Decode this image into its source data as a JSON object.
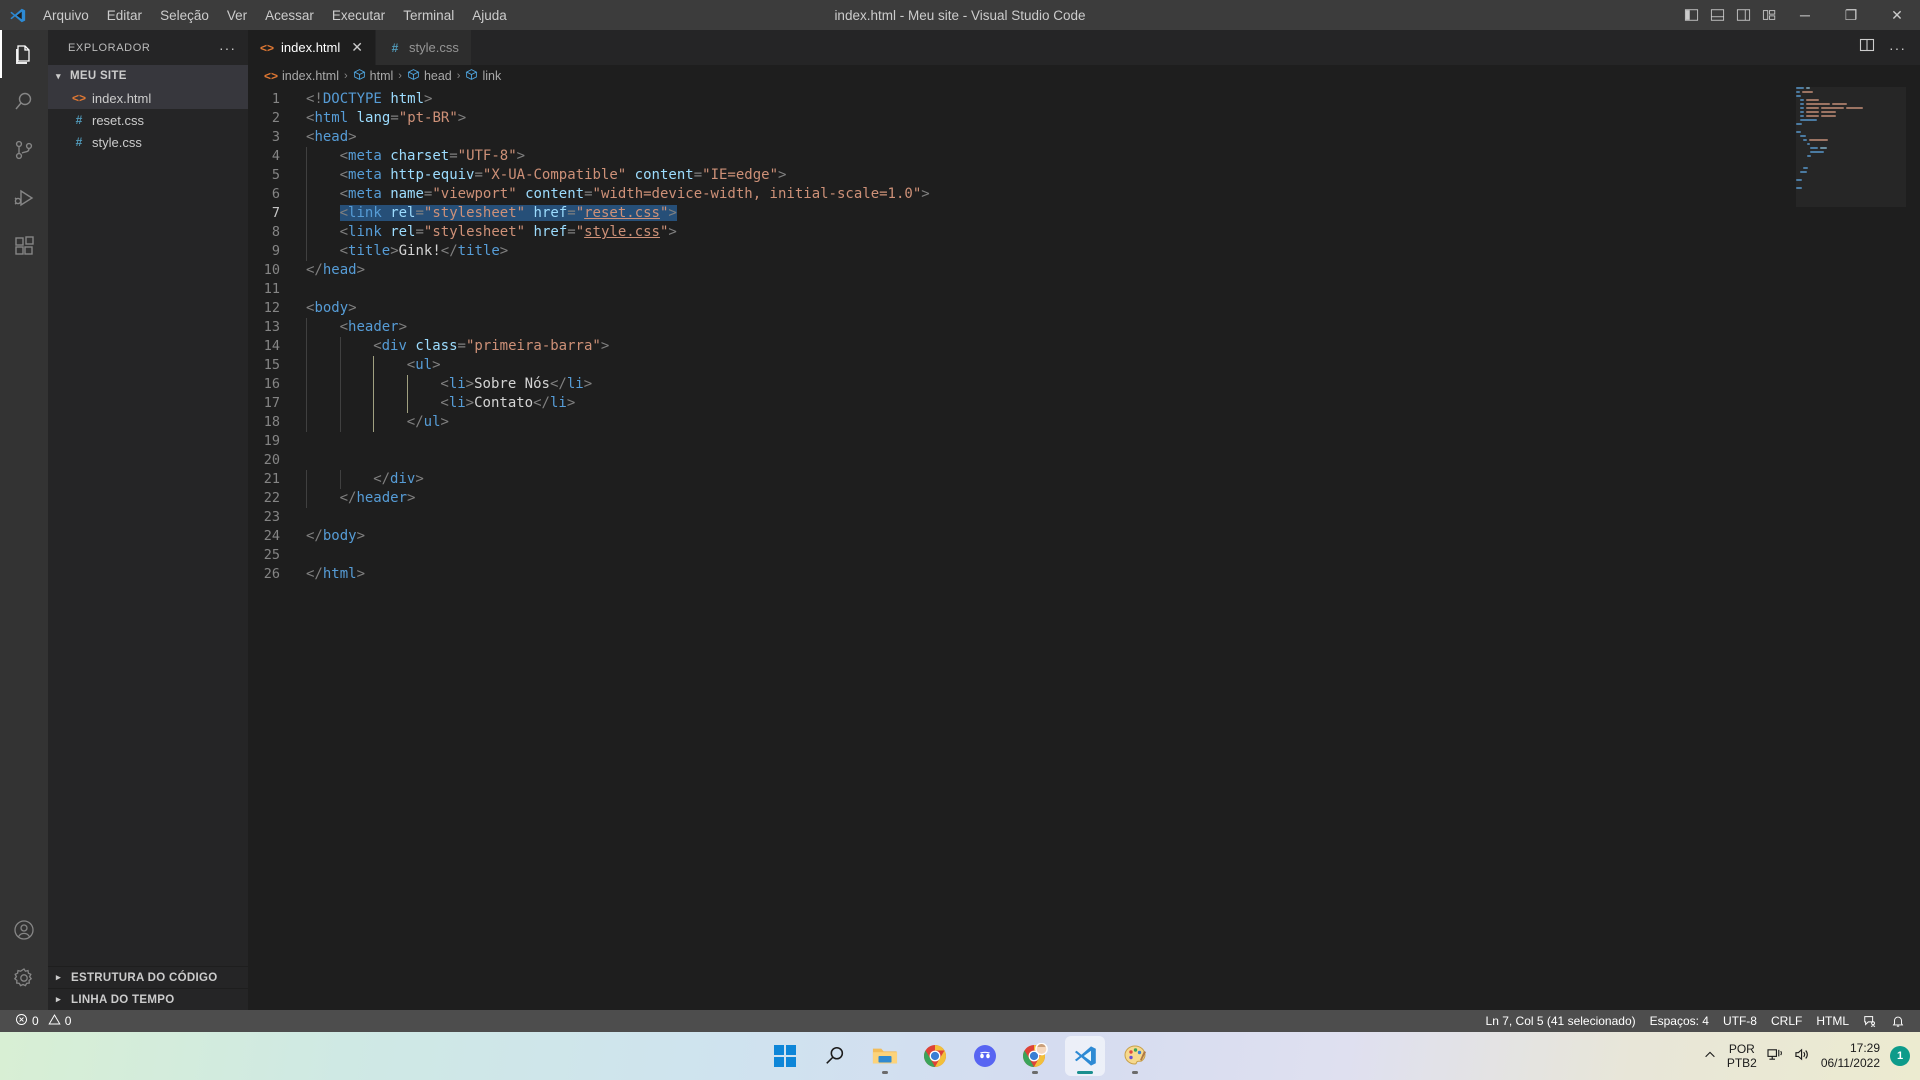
{
  "window": {
    "title": "index.html - Meu site - Visual Studio Code",
    "minimize": "─",
    "restore": "❐",
    "close": "✕"
  },
  "menu": {
    "items": [
      {
        "label": "Arquivo"
      },
      {
        "label": "Editar"
      },
      {
        "label": "Seleção"
      },
      {
        "label": "Ver"
      },
      {
        "label": "Acessar"
      },
      {
        "label": "Executar"
      },
      {
        "label": "Terminal"
      },
      {
        "label": "Ajuda"
      }
    ]
  },
  "activity_bar": {
    "items": [
      {
        "name": "explorer-icon",
        "active": true
      },
      {
        "name": "search-icon",
        "active": false
      },
      {
        "name": "source-control-icon",
        "active": false
      },
      {
        "name": "run-debug-icon",
        "active": false
      },
      {
        "name": "extensions-icon",
        "active": false
      }
    ],
    "bottom": [
      {
        "name": "accounts-icon"
      },
      {
        "name": "settings-gear-icon"
      }
    ]
  },
  "sidebar": {
    "title": "EXPLORADOR",
    "more_actions": "···",
    "folder": {
      "label": "MEU SITE",
      "expanded": true
    },
    "files": [
      {
        "label": "index.html",
        "icon": "html-icon",
        "icon_glyph": "<>",
        "selected": true
      },
      {
        "label": "reset.css",
        "icon": "css-icon",
        "icon_glyph": "#",
        "selected": false
      },
      {
        "label": "style.css",
        "icon": "css-icon",
        "icon_glyph": "#",
        "selected": false
      }
    ],
    "panels": [
      {
        "label": "ESTRUTURA DO CÓDIGO"
      },
      {
        "label": "LINHA DO TEMPO"
      }
    ]
  },
  "tabs": [
    {
      "label": "index.html",
      "icon_glyph": "<>",
      "icon": "html-icon",
      "active": true,
      "close": "✕"
    },
    {
      "label": "style.css",
      "icon_glyph": "#",
      "icon": "css-icon",
      "active": false,
      "close": ""
    }
  ],
  "editor_actions": {
    "split_editor": "split-editor-icon",
    "more_actions": "···"
  },
  "breadcrumb": {
    "separator": "›",
    "items": [
      {
        "label": "index.html",
        "icon": "html-icon"
      },
      {
        "label": "html",
        "icon": "symbol-field-icon"
      },
      {
        "label": "head",
        "icon": "symbol-field-icon"
      },
      {
        "label": "link",
        "icon": "symbol-field-icon"
      }
    ]
  },
  "code": {
    "language": "html",
    "selected_line": 7,
    "lines": [
      {
        "n": 1,
        "text": "<!DOCTYPE html>"
      },
      {
        "n": 2,
        "text": "<html lang=\"pt-BR\">"
      },
      {
        "n": 3,
        "text": "<head>"
      },
      {
        "n": 4,
        "text": "    <meta charset=\"UTF-8\">"
      },
      {
        "n": 5,
        "text": "    <meta http-equiv=\"X-UA-Compatible\" content=\"IE=edge\">"
      },
      {
        "n": 6,
        "text": "    <meta name=\"viewport\" content=\"width=device-width, initial-scale=1.0\">"
      },
      {
        "n": 7,
        "text": "    <link rel=\"stylesheet\" href=\"reset.css\">"
      },
      {
        "n": 8,
        "text": "    <link rel=\"stylesheet\" href=\"style.css\">"
      },
      {
        "n": 9,
        "text": "    <title>Gink!</title>"
      },
      {
        "n": 10,
        "text": "</head>"
      },
      {
        "n": 11,
        "text": ""
      },
      {
        "n": 12,
        "text": "<body>"
      },
      {
        "n": 13,
        "text": "    <header>"
      },
      {
        "n": 14,
        "text": "        <div class=\"primeira-barra\">"
      },
      {
        "n": 15,
        "text": "            <ul>"
      },
      {
        "n": 16,
        "text": "                <li>Sobre Nós</li>"
      },
      {
        "n": 17,
        "text": "                <li>Contato</li>"
      },
      {
        "n": 18,
        "text": "            </ul>"
      },
      {
        "n": 19,
        "text": ""
      },
      {
        "n": 20,
        "text": ""
      },
      {
        "n": 21,
        "text": "        </div>"
      },
      {
        "n": 22,
        "text": "    </header>"
      },
      {
        "n": 23,
        "text": ""
      },
      {
        "n": 24,
        "text": "</body>"
      },
      {
        "n": 25,
        "text": ""
      },
      {
        "n": 26,
        "text": "</html>"
      }
    ]
  },
  "status_bar": {
    "errors": {
      "icon": "error-icon",
      "count": "0"
    },
    "warnings": {
      "icon": "warning-icon",
      "count": "0"
    },
    "cursor": "Ln 7, Col 5 (41 selecionado)",
    "indentation": "Espaços: 4",
    "encoding": "UTF-8",
    "eol": "CRLF",
    "language": "HTML",
    "feedback_icon": "feedback-smiley-icon",
    "bell_icon": "bell-icon"
  },
  "taskbar": {
    "apps": [
      {
        "name": "start-button",
        "label": "Iniciar",
        "running": false,
        "active": false
      },
      {
        "name": "search-taskbar-icon",
        "label": "Pesquisar",
        "running": false,
        "active": false
      },
      {
        "name": "file-explorer-icon",
        "label": "Explorador de Arquivos",
        "running": true,
        "active": false
      },
      {
        "name": "chrome-icon",
        "label": "Google Chrome",
        "running": false,
        "active": false
      },
      {
        "name": "discord-icon",
        "label": "Discord",
        "running": false,
        "active": false
      },
      {
        "name": "chrome-profile-icon",
        "label": "Google Chrome",
        "running": true,
        "active": false
      },
      {
        "name": "vscode-icon",
        "label": "Visual Studio Code",
        "running": true,
        "active": true
      },
      {
        "name": "paint-icon",
        "label": "Paint",
        "running": true,
        "active": false
      }
    ],
    "tray": {
      "overflow_icon": "chevron-up-icon",
      "language_line1": "POR",
      "language_line2": "PTB2",
      "network_icon": "network-icon",
      "volume_icon": "volume-icon",
      "time": "17:29",
      "date": "06/11/2022",
      "notification_count": "1"
    }
  },
  "colors": {
    "accent_html": "#e37933",
    "accent_css": "#519aba",
    "selection": "#264f78",
    "statusbar_bg": "#4d4d4d",
    "editor_bg": "#1e1e1e",
    "sidebar_bg": "#252526"
  }
}
